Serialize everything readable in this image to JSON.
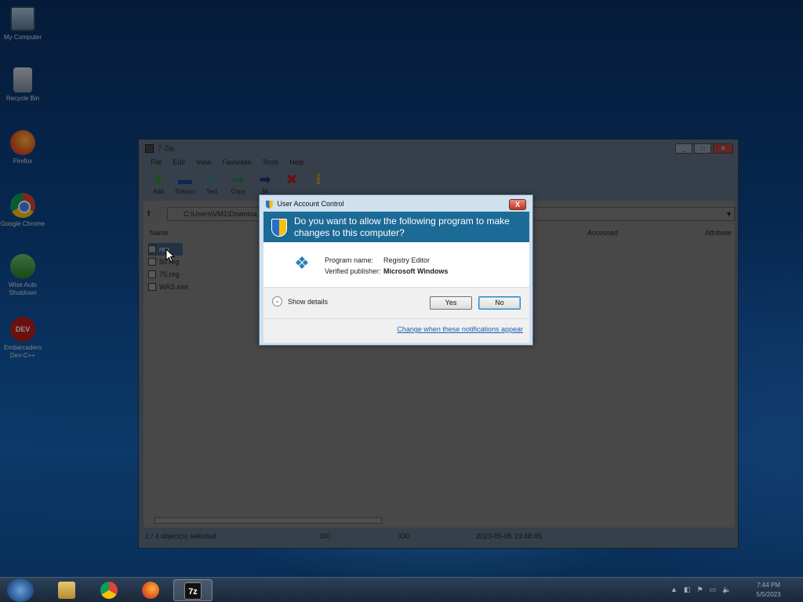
{
  "desktop": {
    "icons": [
      {
        "label": "My Computer",
        "icon": "computer-icon"
      },
      {
        "label": "Recycle Bin",
        "icon": "recycle-bin-icon"
      },
      {
        "label": "Firefox",
        "icon": "firefox-icon"
      },
      {
        "label": "Google Chrome",
        "icon": "chrome-icon"
      },
      {
        "label": "Wise Auto Shutdown",
        "icon": "wise-icon"
      },
      {
        "label": "Embarcadero Dev-C++",
        "icon": "devcpp-icon"
      }
    ]
  },
  "window": {
    "title": "7-Zip",
    "menu": [
      "File",
      "Edit",
      "View",
      "Favorites",
      "Tools",
      "Help"
    ],
    "toolbar": [
      {
        "label": "Add",
        "icon": "add-icon"
      },
      {
        "label": "Extract",
        "icon": "extract-icon"
      },
      {
        "label": "Test",
        "icon": "test-icon"
      },
      {
        "label": "Copy",
        "icon": "copy-icon"
      },
      {
        "label": "M",
        "icon": "move-icon"
      },
      {
        "label": "",
        "icon": "delete-icon"
      },
      {
        "label": "",
        "icon": "info-icon"
      }
    ],
    "address": "C:\\Users\\VM1\\Downloa",
    "columns": {
      "name": "Name",
      "accessed": "Accessed",
      "attributes": "Attribute"
    },
    "files": [
      {
        "name": "reg",
        "selected": true
      },
      {
        "name": "50.reg",
        "selected": false
      },
      {
        "name": "75.reg",
        "selected": false
      },
      {
        "name": "WAS.exe",
        "selected": false
      }
    ],
    "status": {
      "selection": "1 / 4 object(s) selected",
      "size": "330",
      "packed": "330",
      "modified": "2023-05-05 19:48:45"
    }
  },
  "uac": {
    "title": "User Account Control",
    "question": "Do you want to allow the following program to make changes to this computer?",
    "program_name_label": "Program name:",
    "program_name": "Registry Editor",
    "publisher_label": "Verified publisher:",
    "publisher": "Microsoft Windows",
    "show_details": "Show details",
    "yes": "Yes",
    "no": "No",
    "link": "Change when these notifications appear",
    "close": "X"
  },
  "taskbar": {
    "items": [
      "explorer-icon",
      "chrome-icon",
      "firefox-icon",
      "7zip-icon"
    ],
    "sevenzip_label": "7z",
    "clock_time": "7:44 PM",
    "clock_date": "5/5/2023"
  }
}
